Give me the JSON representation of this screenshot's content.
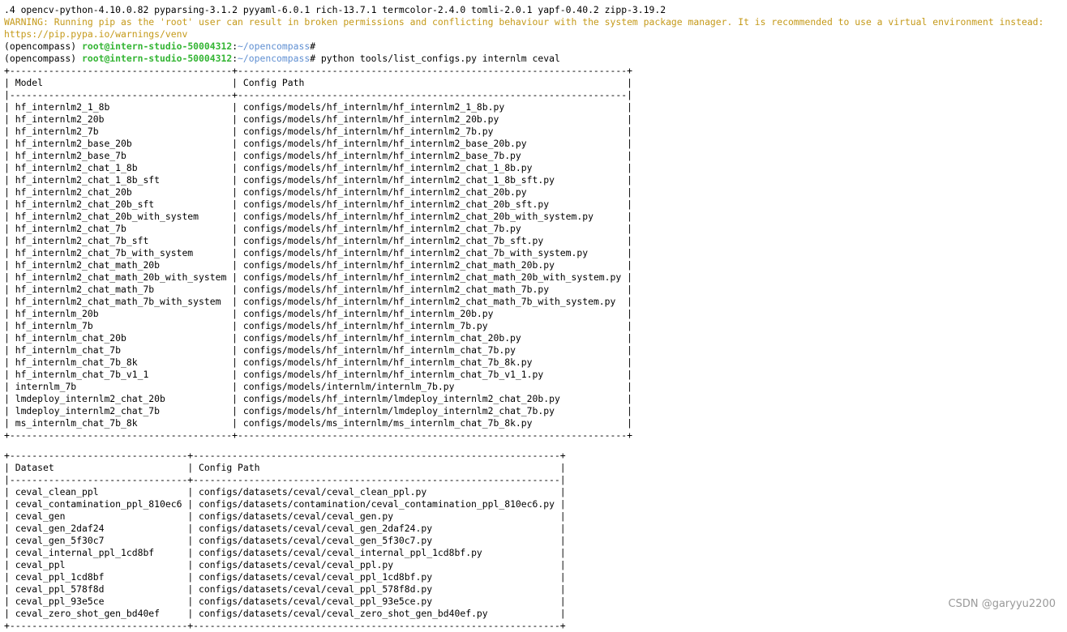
{
  "terminal": {
    "pkg_line": ".4 opencv-python-4.10.0.82 pyparsing-3.1.2 pyyaml-6.0.1 rich-13.7.1 termcolor-2.4.0 tomli-2.0.1 yapf-0.40.2 zipp-3.19.2",
    "warning_line": "WARNING: Running pip as the 'root' user can result in broken permissions and conflicting behaviour with the system package manager. It is recommended to use a virtual environment instead:",
    "warning_url": "https://pip.pypa.io/warnings/venv",
    "prompt1": {
      "env": "(opencompass) ",
      "user": "root@intern-studio-50004312",
      "sep": ":",
      "path": "~/opencompass",
      "end": "#",
      "cmd": ""
    },
    "prompt2": {
      "env": "(opencompass) ",
      "user": "root@intern-studio-50004312",
      "sep": ":",
      "path": "~/opencompass",
      "end": "#",
      "cmd": " python tools/list_configs.py internlm ceval"
    }
  },
  "model_table": {
    "headers": [
      "Model",
      "Config Path"
    ],
    "rows": [
      [
        "hf_internlm2_1_8b",
        "configs/models/hf_internlm/hf_internlm2_1_8b.py"
      ],
      [
        "hf_internlm2_20b",
        "configs/models/hf_internlm/hf_internlm2_20b.py"
      ],
      [
        "hf_internlm2_7b",
        "configs/models/hf_internlm/hf_internlm2_7b.py"
      ],
      [
        "hf_internlm2_base_20b",
        "configs/models/hf_internlm/hf_internlm2_base_20b.py"
      ],
      [
        "hf_internlm2_base_7b",
        "configs/models/hf_internlm/hf_internlm2_base_7b.py"
      ],
      [
        "hf_internlm2_chat_1_8b",
        "configs/models/hf_internlm/hf_internlm2_chat_1_8b.py"
      ],
      [
        "hf_internlm2_chat_1_8b_sft",
        "configs/models/hf_internlm/hf_internlm2_chat_1_8b_sft.py"
      ],
      [
        "hf_internlm2_chat_20b",
        "configs/models/hf_internlm/hf_internlm2_chat_20b.py"
      ],
      [
        "hf_internlm2_chat_20b_sft",
        "configs/models/hf_internlm/hf_internlm2_chat_20b_sft.py"
      ],
      [
        "hf_internlm2_chat_20b_with_system",
        "configs/models/hf_internlm/hf_internlm2_chat_20b_with_system.py"
      ],
      [
        "hf_internlm2_chat_7b",
        "configs/models/hf_internlm/hf_internlm2_chat_7b.py"
      ],
      [
        "hf_internlm2_chat_7b_sft",
        "configs/models/hf_internlm/hf_internlm2_chat_7b_sft.py"
      ],
      [
        "hf_internlm2_chat_7b_with_system",
        "configs/models/hf_internlm/hf_internlm2_chat_7b_with_system.py"
      ],
      [
        "hf_internlm2_chat_math_20b",
        "configs/models/hf_internlm/hf_internlm2_chat_math_20b.py"
      ],
      [
        "hf_internlm2_chat_math_20b_with_system",
        "configs/models/hf_internlm/hf_internlm2_chat_math_20b_with_system.py"
      ],
      [
        "hf_internlm2_chat_math_7b",
        "configs/models/hf_internlm/hf_internlm2_chat_math_7b.py"
      ],
      [
        "hf_internlm2_chat_math_7b_with_system",
        "configs/models/hf_internlm/hf_internlm2_chat_math_7b_with_system.py"
      ],
      [
        "hf_internlm_20b",
        "configs/models/hf_internlm/hf_internlm_20b.py"
      ],
      [
        "hf_internlm_7b",
        "configs/models/hf_internlm/hf_internlm_7b.py"
      ],
      [
        "hf_internlm_chat_20b",
        "configs/models/hf_internlm/hf_internlm_chat_20b.py"
      ],
      [
        "hf_internlm_chat_7b",
        "configs/models/hf_internlm/hf_internlm_chat_7b.py"
      ],
      [
        "hf_internlm_chat_7b_8k",
        "configs/models/hf_internlm/hf_internlm_chat_7b_8k.py"
      ],
      [
        "hf_internlm_chat_7b_v1_1",
        "configs/models/hf_internlm/hf_internlm_chat_7b_v1_1.py"
      ],
      [
        "internlm_7b",
        "configs/models/internlm/internlm_7b.py"
      ],
      [
        "lmdeploy_internlm2_chat_20b",
        "configs/models/hf_internlm/lmdeploy_internlm2_chat_20b.py"
      ],
      [
        "lmdeploy_internlm2_chat_7b",
        "configs/models/hf_internlm/lmdeploy_internlm2_chat_7b.py"
      ],
      [
        "ms_internlm_chat_7b_8k",
        "configs/models/ms_internlm/ms_internlm_chat_7b_8k.py"
      ]
    ]
  },
  "dataset_table": {
    "headers": [
      "Dataset",
      "Config Path"
    ],
    "rows": [
      [
        "ceval_clean_ppl",
        "configs/datasets/ceval/ceval_clean_ppl.py"
      ],
      [
        "ceval_contamination_ppl_810ec6",
        "configs/datasets/contamination/ceval_contamination_ppl_810ec6.py"
      ],
      [
        "ceval_gen",
        "configs/datasets/ceval/ceval_gen.py"
      ],
      [
        "ceval_gen_2daf24",
        "configs/datasets/ceval/ceval_gen_2daf24.py"
      ],
      [
        "ceval_gen_5f30c7",
        "configs/datasets/ceval/ceval_gen_5f30c7.py"
      ],
      [
        "ceval_internal_ppl_1cd8bf",
        "configs/datasets/ceval/ceval_internal_ppl_1cd8bf.py"
      ],
      [
        "ceval_ppl",
        "configs/datasets/ceval/ceval_ppl.py"
      ],
      [
        "ceval_ppl_1cd8bf",
        "configs/datasets/ceval/ceval_ppl_1cd8bf.py"
      ],
      [
        "ceval_ppl_578f8d",
        "configs/datasets/ceval/ceval_ppl_578f8d.py"
      ],
      [
        "ceval_ppl_93e5ce",
        "configs/datasets/ceval/ceval_ppl_93e5ce.py"
      ],
      [
        "ceval_zero_shot_gen_bd40ef",
        "configs/datasets/ceval/ceval_zero_shot_gen_bd40ef.py"
      ]
    ]
  },
  "watermark": "CSDN @garyyu2200"
}
